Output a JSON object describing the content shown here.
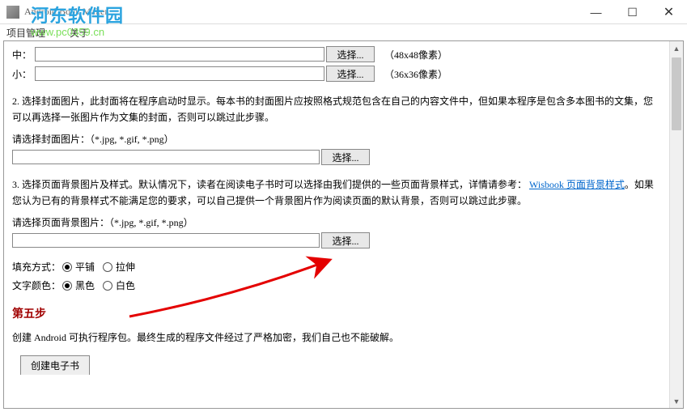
{
  "window": {
    "title": "Android Book Maker",
    "min": "—",
    "max": "☐",
    "close": "✕"
  },
  "menu": {
    "project": "项目管理",
    "about": "关于"
  },
  "icons": {
    "mid_label": "中：",
    "mid_hint": "（48x48像素）",
    "small_label": "小：",
    "small_hint": "（36x36像素）",
    "browse": "选择..."
  },
  "step2": {
    "text": "2. 选择封面图片，此封面将在程序启动时显示。每本书的封面图片应按照格式规范包含在自己的内容文件中，但如果本程序是包含多本图书的文集，您可以再选择一张图片作为文集的封面，否则可以跳过此步骤。",
    "label": "请选择封面图片：（*.jpg, *.gif, *.png）",
    "browse": "选择..."
  },
  "step3": {
    "text_before": "3. 选择页面背景图片及样式。默认情况下，读者在阅读电子书时可以选择由我们提供的一些页面背景样式，详情请参考：",
    "link": "Wisbook 页面背景样式",
    "text_after": "。如果您认为已有的背景样式不能满足您的要求，可以自己提供一个背景图片作为阅读页面的默认背景，否则可以跳过此步骤。",
    "label": "请选择页面背景图片：（*.jpg, *.gif, *.png）",
    "browse": "选择..."
  },
  "fill": {
    "label": "填充方式：",
    "opt1": "平铺",
    "opt2": "拉伸"
  },
  "textcolor": {
    "label": "文字颜色：",
    "opt1": "黑色",
    "opt2": "白色"
  },
  "step5": {
    "heading": "第五步",
    "text": "创建 Android 可执行程序包。最终生成的程序文件经过了严格加密，我们自己也不能破解。",
    "build": "创建电子书"
  },
  "watermark": {
    "cn": "河东软件园",
    "url": "www.pc0359.cn"
  }
}
